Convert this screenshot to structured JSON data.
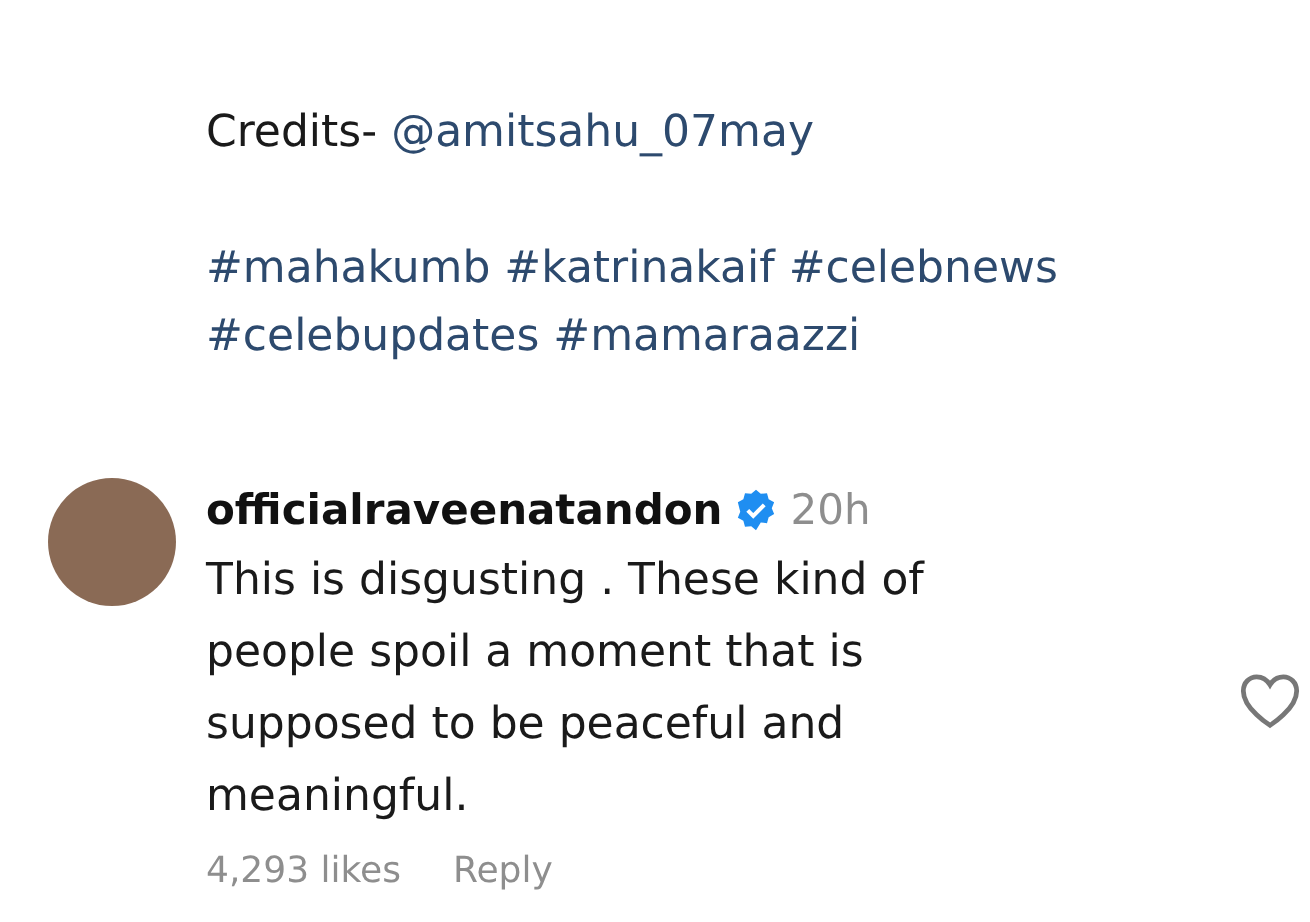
{
  "caption": {
    "credits_label": "Credits-",
    "credits_mention": "@amitsahu_07may",
    "hashtag_lines": [
      "#mahakumb #katrinakaif #celebnews",
      "#celebupdates #mamaraazzi"
    ]
  },
  "comment": {
    "username": "officialraveenatandon",
    "verified": true,
    "time": "20h",
    "text": "This is disgusting . These kind of people spoil a moment that is supposed to be peaceful and meaningful.",
    "likes": "4,293 likes",
    "reply": "Reply"
  }
}
